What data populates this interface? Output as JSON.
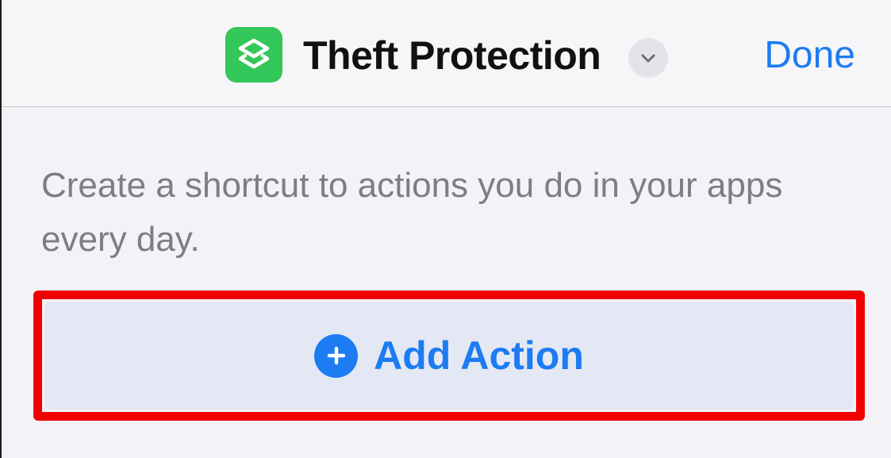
{
  "nav": {
    "title": "Theft Protection",
    "done_label": "Done",
    "app_icon": "shortcuts-icon",
    "chevron_icon": "chevron-down-icon"
  },
  "editor": {
    "empty_hint": "Create a shortcut to actions you do in your apps every day.",
    "add_action_label": "Add Action",
    "add_action_icon": "plus-circle-icon"
  },
  "colors": {
    "accent": "#1d7cf2",
    "app_icon_bg": "#34c759",
    "highlight": "#f00000",
    "background": "#f2f2f7"
  }
}
